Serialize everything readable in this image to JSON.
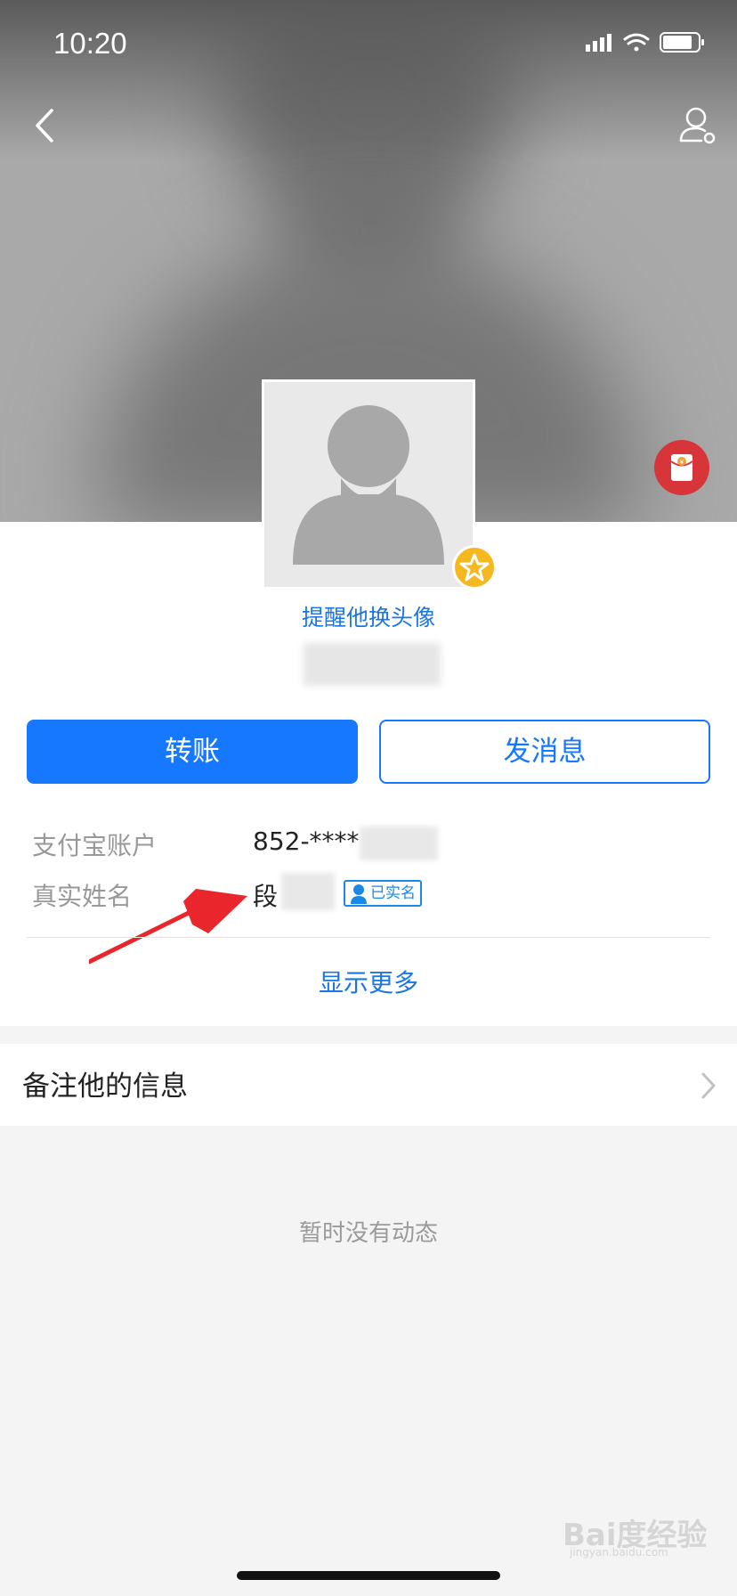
{
  "status_bar": {
    "time": "10:20"
  },
  "profile": {
    "remind_avatar_link": "提醒他换头像"
  },
  "actions": {
    "transfer_label": "转账",
    "message_label": "发消息"
  },
  "info": {
    "account_label": "支付宝账户",
    "account_value": "852-****",
    "realname_label": "真实姓名",
    "realname_value": "段",
    "verified_badge": "已实名"
  },
  "show_more": "显示更多",
  "note_row": {
    "label": "备注他的信息"
  },
  "empty_state": "暂时没有动态",
  "watermark": {
    "text": "Bai度经验",
    "sub": "jingyan.baidu.com"
  },
  "colors": {
    "accent": "#1677ff",
    "link": "#1b76e4",
    "red_packet": "#d8353b",
    "star_badge": "#f5b81f",
    "annotation_arrow": "#e8262b"
  },
  "icons": [
    "back-icon",
    "profile-settings-icon",
    "red-packet-icon",
    "star-badge-icon",
    "verified-icon",
    "chevron-right-icon",
    "signal-icon",
    "wifi-icon",
    "battery-icon"
  ]
}
